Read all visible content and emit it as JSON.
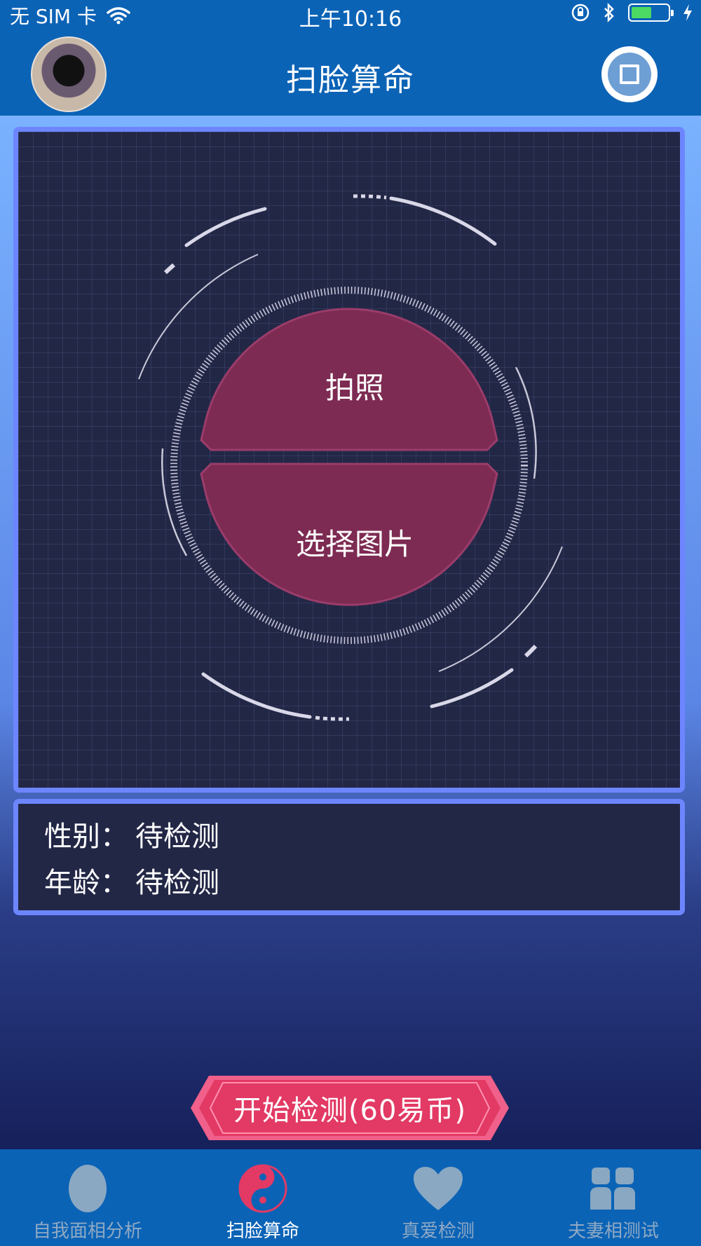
{
  "status_bar": {
    "carrier": "无 SIM 卡",
    "time": "上午10:16",
    "battery_level": 0.55,
    "battery_color": "#4cd964"
  },
  "header": {
    "title": "扫脸算命",
    "avatar_icon": "avatar-photo",
    "right_icon": "stop-icon"
  },
  "scanner": {
    "take_photo_label": "拍照",
    "choose_image_label": "选择图片",
    "lens_color": "#7d2b52",
    "frame_color": "#6d86ff"
  },
  "info": {
    "gender_label": "性别：",
    "gender_value": "待检测",
    "age_label": "年龄：",
    "age_value": "待检测"
  },
  "action": {
    "start_label": "开始检测(60易币)",
    "button_color": "#e23a64"
  },
  "tabs": [
    {
      "label": "自我面相分析",
      "icon": "face-icon",
      "active": false
    },
    {
      "label": "扫脸算命",
      "icon": "yin-yang-icon",
      "active": true
    },
    {
      "label": "真爱检测",
      "icon": "heart-icon",
      "active": false
    },
    {
      "label": "夫妻相测试",
      "icon": "couple-icon",
      "active": false
    }
  ]
}
